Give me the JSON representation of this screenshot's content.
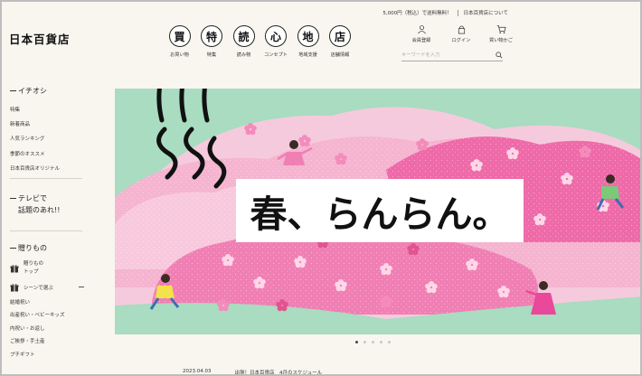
{
  "topbar": {
    "shipping": "5,000円（税込）で送料無料！",
    "about": "日本百貨店について"
  },
  "logo": "日本百貨店",
  "categories": [
    {
      "char": "買",
      "label": "お買い物"
    },
    {
      "char": "特",
      "label": "特集"
    },
    {
      "char": "読",
      "label": "読み物"
    },
    {
      "char": "心",
      "label": "コンセプト"
    },
    {
      "char": "地",
      "label": "地域支援"
    },
    {
      "char": "店",
      "label": "店舗情報"
    }
  ],
  "account": {
    "register": "会員登録",
    "login": "ログイン",
    "cart": "買い物かご"
  },
  "search": {
    "placeholder": "キーワードを入力"
  },
  "sidebar": {
    "ichioshi_title": "イチオシ",
    "ichioshi_items": [
      "特集",
      "新着商品",
      "人気ランキング",
      "季節のオススメ",
      "日本百貨店オリジナル"
    ],
    "tv_line1": "テレビで",
    "tv_line2": "話題のあれ!!",
    "gift_title": "贈りもの",
    "gift_top": "贈りもの",
    "gift_top2": "トップ",
    "gift_scene": "シーンで選ぶ",
    "gift_items": [
      "結婚祝い",
      "出産祝い・ベビーキッズ",
      "内祝い・お返し",
      "ご挨拶・手土産",
      "プチギフト"
    ]
  },
  "hero": {
    "title": "春、らんらん。"
  },
  "news": {
    "date": "2023.04.03",
    "text": "出張！日本百貨店　4月のスケジュール"
  },
  "colors": {
    "bg": "#f8f6ef",
    "hero_green": "#a9dcc0",
    "pink": "#f07fb4",
    "light_pink": "#f9c6dc"
  }
}
